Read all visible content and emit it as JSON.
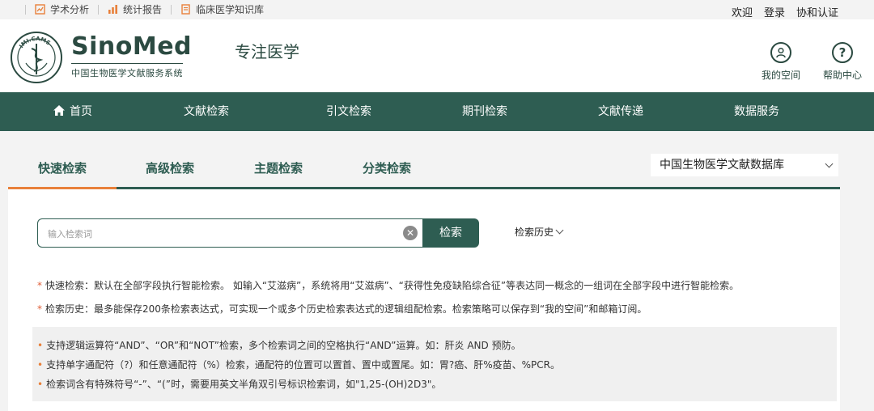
{
  "topbar": {
    "links": [
      {
        "label": "学术分析",
        "icon": "analysis-icon"
      },
      {
        "label": "统计报告",
        "icon": "bar-chart-icon"
      },
      {
        "label": "临床医学知识库",
        "icon": "document-icon"
      }
    ],
    "welcome": "欢迎",
    "login": "登录",
    "union_auth": "协和认证"
  },
  "header": {
    "brand": "SinoMed",
    "brand_sub": "中国生物医学文献服务系统",
    "slogan": "专注医学",
    "my_space": "我的空间",
    "help": "帮助中心",
    "seal_text": "IMI.CAMS"
  },
  "nav": {
    "items": [
      "首页",
      "文献检索",
      "引文检索",
      "期刊检索",
      "文献传递",
      "数据服务"
    ]
  },
  "tabs": [
    "快速检索",
    "高级检索",
    "主题检索",
    "分类检索"
  ],
  "database": {
    "selected": "中国生物医学文献数据库"
  },
  "search": {
    "placeholder": "输入检索词",
    "button": "检索",
    "history": "检索历史"
  },
  "notes": [
    "快速检索：默认在全部字段执行智能检索。 如输入“艾滋病”，系统将用“艾滋病”、“获得性免疫缺陷综合征”等表达同一概念的一组词在全部字段中进行智能检索。",
    "检索历史：最多能保存200条检索表达式，可实现一个或多个历史检索表达式的逻辑组配检索。检索策略可以保存到“我的空间”和邮箱订阅。"
  ],
  "tips": [
    "支持逻辑运算符“AND”、“OR”和“NOT”检索，多个检索词之间的空格执行“AND”运算。如：肝炎 AND 预防。",
    "支持单字通配符（?）和任意通配符（%）检索，通配符的位置可以置首、置中或置尾。如：胃?癌、肝%疫苗、%PCR。",
    "检索词含有特殊符号“-”、“(”时，需要用英文半角双引号标识检索词，如\"1,25-(OH)2D3\"。"
  ],
  "colors": {
    "primary": "#2e5d52",
    "accent": "#e8803a"
  }
}
